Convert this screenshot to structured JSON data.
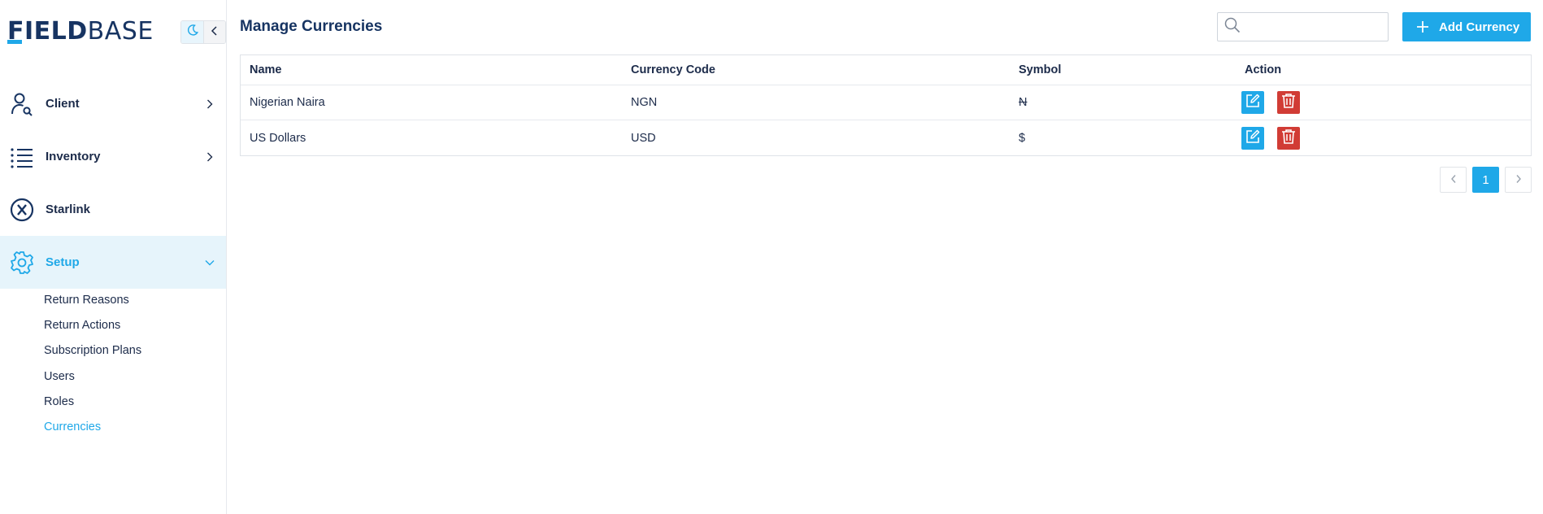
{
  "brand": {
    "logo_bold": "FIELD",
    "logo_thin": "BASE",
    "accent": "#1fa8e8",
    "navy": "#173462",
    "danger": "#d13c35"
  },
  "sidebar": {
    "theme_toggle_icon": "moon-icon",
    "collapse_icon": "chevron-left-icon",
    "items": [
      {
        "label": "Client",
        "icon": "user-search-icon",
        "expandable": true,
        "expanded": false
      },
      {
        "label": "Inventory",
        "icon": "list-icon",
        "expandable": true,
        "expanded": false
      },
      {
        "label": "Starlink",
        "icon": "circle-x-icon",
        "expandable": false
      },
      {
        "label": "Setup",
        "icon": "gear-icon",
        "expandable": true,
        "expanded": true,
        "active": true
      }
    ],
    "setup_children": [
      {
        "label": "Return Reasons"
      },
      {
        "label": "Return Actions"
      },
      {
        "label": "Subscription Plans"
      },
      {
        "label": "Users"
      },
      {
        "label": "Roles"
      },
      {
        "label": "Currencies",
        "active": true
      }
    ]
  },
  "header": {
    "title": "Manage Currencies",
    "search": {
      "value": "",
      "placeholder": ""
    },
    "add_button_label": "Add Currency"
  },
  "table": {
    "columns": [
      "Name",
      "Currency Code",
      "Symbol",
      "Action"
    ],
    "rows": [
      {
        "name": "Nigerian Naira",
        "code": "NGN",
        "symbol": "N"
      },
      {
        "name": "US Dollars",
        "code": "USD",
        "symbol": "$"
      }
    ]
  },
  "pagination": {
    "current_page": "1",
    "prev_icon": "chevron-left-icon",
    "next_icon": "chevron-right-icon"
  }
}
